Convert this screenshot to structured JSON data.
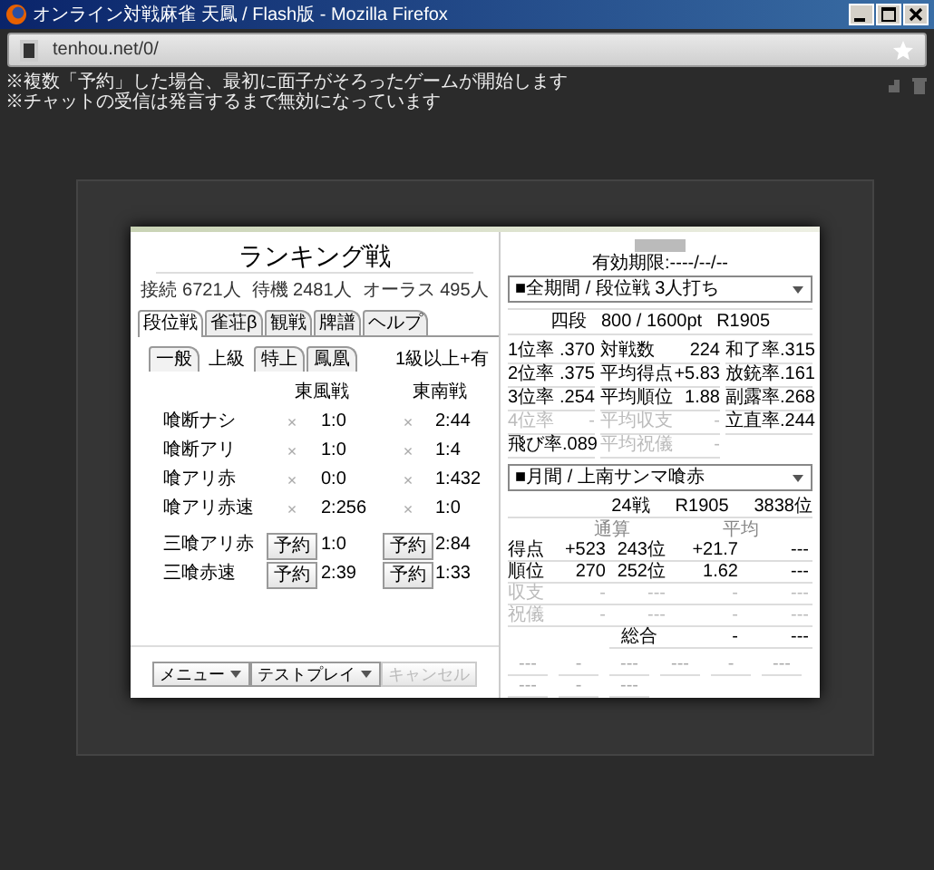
{
  "window": {
    "title": "オンライン対戦麻雀 天鳳 / Flash版 - Mozilla Firefox"
  },
  "address_bar": {
    "url": "tenhou.net/0/"
  },
  "notices": [
    "※複数「予約」した場合、最初に面子がそろったゲームが開始します",
    "※チャットの受信は発言するまで無効になっています"
  ],
  "lobby": {
    "title": "ランキング戦",
    "stats": [
      "接続 6721人",
      "待機 2481人",
      "オーラス 495人"
    ],
    "tabs": [
      {
        "label": "段位戦",
        "selected": true
      },
      {
        "label": "雀荘β",
        "selected": false
      },
      {
        "label": "観戦",
        "selected": false
      },
      {
        "label": "牌譜",
        "selected": false
      },
      {
        "label": "ヘルプ",
        "selected": false
      }
    ],
    "subtabs": [
      {
        "label": "一般",
        "selected": false
      },
      {
        "label": "上級",
        "selected": true
      },
      {
        "label": "特上",
        "selected": false
      },
      {
        "label": "鳳凰",
        "selected": false
      }
    ],
    "rank_note": "1級以上+有",
    "columns": [
      "東風戦",
      "東南戦"
    ],
    "rows": [
      {
        "name": "喰断ナシ",
        "cells": [
          {
            "kind": "mark",
            "text": "×",
            "value": "1:0"
          },
          {
            "kind": "mark",
            "text": "×",
            "value": "2:44"
          }
        ]
      },
      {
        "name": "喰断アリ",
        "cells": [
          {
            "kind": "mark",
            "text": "×",
            "value": "1:0"
          },
          {
            "kind": "mark",
            "text": "×",
            "value": "1:4"
          }
        ]
      },
      {
        "name": "喰アリ赤",
        "cells": [
          {
            "kind": "mark",
            "text": "×",
            "value": "0:0"
          },
          {
            "kind": "mark",
            "text": "×",
            "value": "1:432"
          }
        ]
      },
      {
        "name": "喰アリ赤速",
        "cells": [
          {
            "kind": "mark",
            "text": "×",
            "value": "2:256"
          },
          {
            "kind": "mark",
            "text": "×",
            "value": "1:0"
          }
        ]
      },
      {
        "name": "三喰アリ赤",
        "cells": [
          {
            "kind": "button",
            "text": "予約",
            "value": "1:0"
          },
          {
            "kind": "button",
            "text": "予約",
            "value": "2:84"
          }
        ]
      },
      {
        "name": "三喰赤速",
        "cells": [
          {
            "kind": "button",
            "text": "予約",
            "value": "2:39"
          },
          {
            "kind": "button",
            "text": "予約",
            "value": "1:33"
          }
        ]
      }
    ],
    "menu_buttons": [
      {
        "label": "メニュー",
        "dropdown": true,
        "disabled": false
      },
      {
        "label": "テストプレイ",
        "dropdown": true,
        "disabled": false
      },
      {
        "label": "キャンセル",
        "dropdown": false,
        "disabled": true
      }
    ]
  },
  "profile": {
    "expiry": "有効期限:----/--/--",
    "mode_select": "■全期間 / 段位戦 3人打ち",
    "rank_line": [
      "四段",
      "800 / 1600pt",
      "R1905"
    ],
    "stats": [
      [
        {
          "label": "1位率",
          "value": ".370",
          "disabled": false
        },
        {
          "label": "対戦数",
          "value": "224",
          "disabled": false
        },
        {
          "label": "和了率",
          "value": ".315",
          "disabled": false
        }
      ],
      [
        {
          "label": "2位率",
          "value": ".375",
          "disabled": false
        },
        {
          "label": "平均得点",
          "value": "+5.83",
          "disabled": false
        },
        {
          "label": "放銃率",
          "value": ".161",
          "disabled": false
        }
      ],
      [
        {
          "label": "3位率",
          "value": ".254",
          "disabled": false
        },
        {
          "label": "平均順位",
          "value": "1.88",
          "disabled": false
        },
        {
          "label": "副露率",
          "value": ".268",
          "disabled": false
        }
      ],
      [
        {
          "label": "4位率",
          "value": "-",
          "disabled": true
        },
        {
          "label": "平均収支",
          "value": "-",
          "disabled": true
        },
        {
          "label": "立直率",
          "value": ".244",
          "disabled": false
        }
      ],
      [
        {
          "label": "飛び率",
          "value": ".089",
          "disabled": false
        },
        {
          "label": "平均祝儀",
          "value": "-",
          "disabled": true
        }
      ]
    ],
    "period_select": "■月間 / 上南サンマ喰赤",
    "summary": [
      "24戦",
      "R1905",
      "3838位"
    ],
    "table": {
      "headers": [
        "通算",
        "平均"
      ],
      "rows": [
        {
          "label": "得点",
          "cells": [
            "+523",
            "243位",
            "+21.7",
            "---"
          ],
          "disabled": false
        },
        {
          "label": "順位",
          "cells": [
            "270",
            "252位",
            "1.62",
            "---"
          ],
          "disabled": false
        },
        {
          "label": "収支",
          "cells": [
            "-",
            "---",
            "-",
            "---"
          ],
          "disabled": true
        },
        {
          "label": "祝儀",
          "cells": [
            "-",
            "---",
            "-",
            "---"
          ],
          "disabled": true
        }
      ]
    },
    "total": {
      "label": "総合",
      "cells": [
        "-",
        "---"
      ]
    },
    "extra_rows": [
      [
        "---",
        "-",
        "---",
        "---",
        "-",
        "---"
      ],
      [
        "---",
        "-",
        "---"
      ]
    ]
  }
}
